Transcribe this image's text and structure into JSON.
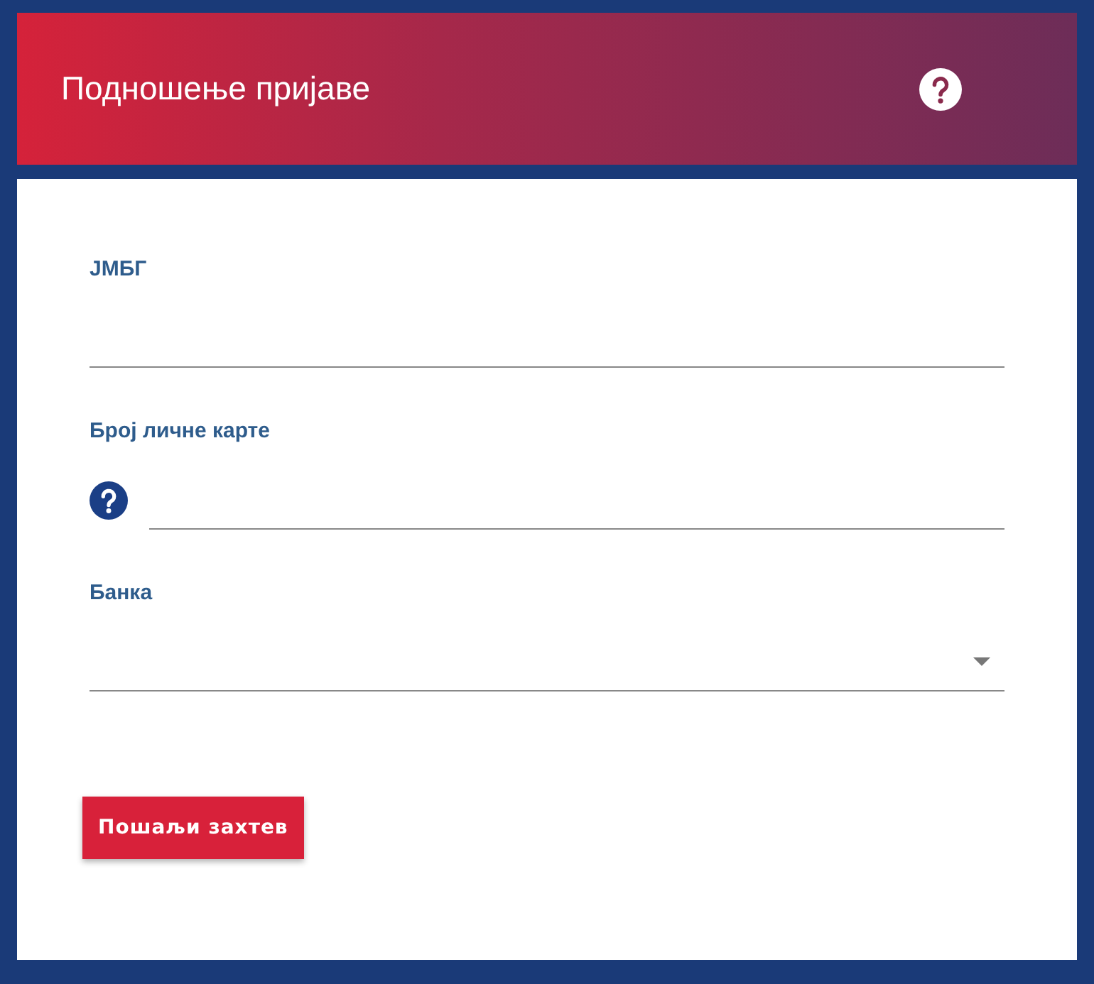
{
  "header": {
    "title": "Подношење пријаве",
    "help": true
  },
  "fields": [
    {
      "label": "ЈМБГ",
      "kind": "text",
      "help": false
    },
    {
      "label": "Број личне карте",
      "kind": "text",
      "help": true
    },
    {
      "label": "Банка",
      "kind": "select",
      "help": false
    }
  ],
  "submit_button": "Пошаљи захтев"
}
